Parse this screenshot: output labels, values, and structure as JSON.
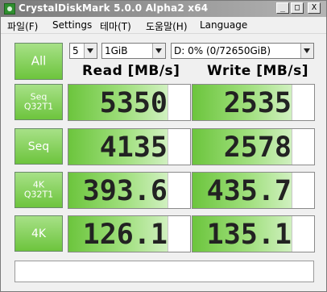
{
  "window": {
    "title": "CrystalDiskMark 5.0.0 Alpha2 x64",
    "buttons": {
      "minimize": "_",
      "maximize": "□",
      "close": "X"
    }
  },
  "menu": [
    "파일(F)",
    "Settings",
    "테마(T)",
    "도움말(H)",
    "Language"
  ],
  "controls": {
    "runs": "5",
    "size": "1GiB",
    "drive": "D: 0% (0/72650GiB)",
    "all_label": "All"
  },
  "headers": {
    "read": "Read [MB/s]",
    "write": "Write [MB/s]"
  },
  "rows": [
    {
      "label1": "Seq",
      "label2": "Q32T1",
      "read": "5350",
      "write": "2535"
    },
    {
      "label1": "Seq",
      "label2": "",
      "read": "4135",
      "write": "2578"
    },
    {
      "label1": "4K",
      "label2": "Q32T1",
      "read": "393.6",
      "write": "435.7"
    },
    {
      "label1": "4K",
      "label2": "",
      "read": "126.1",
      "write": "135.1"
    }
  ],
  "status_text": "",
  "colors": {
    "accent": "#6dc43d",
    "title_bar": "#7a7a7a"
  },
  "icons": {
    "app": "crystaldiskmark-icon"
  }
}
